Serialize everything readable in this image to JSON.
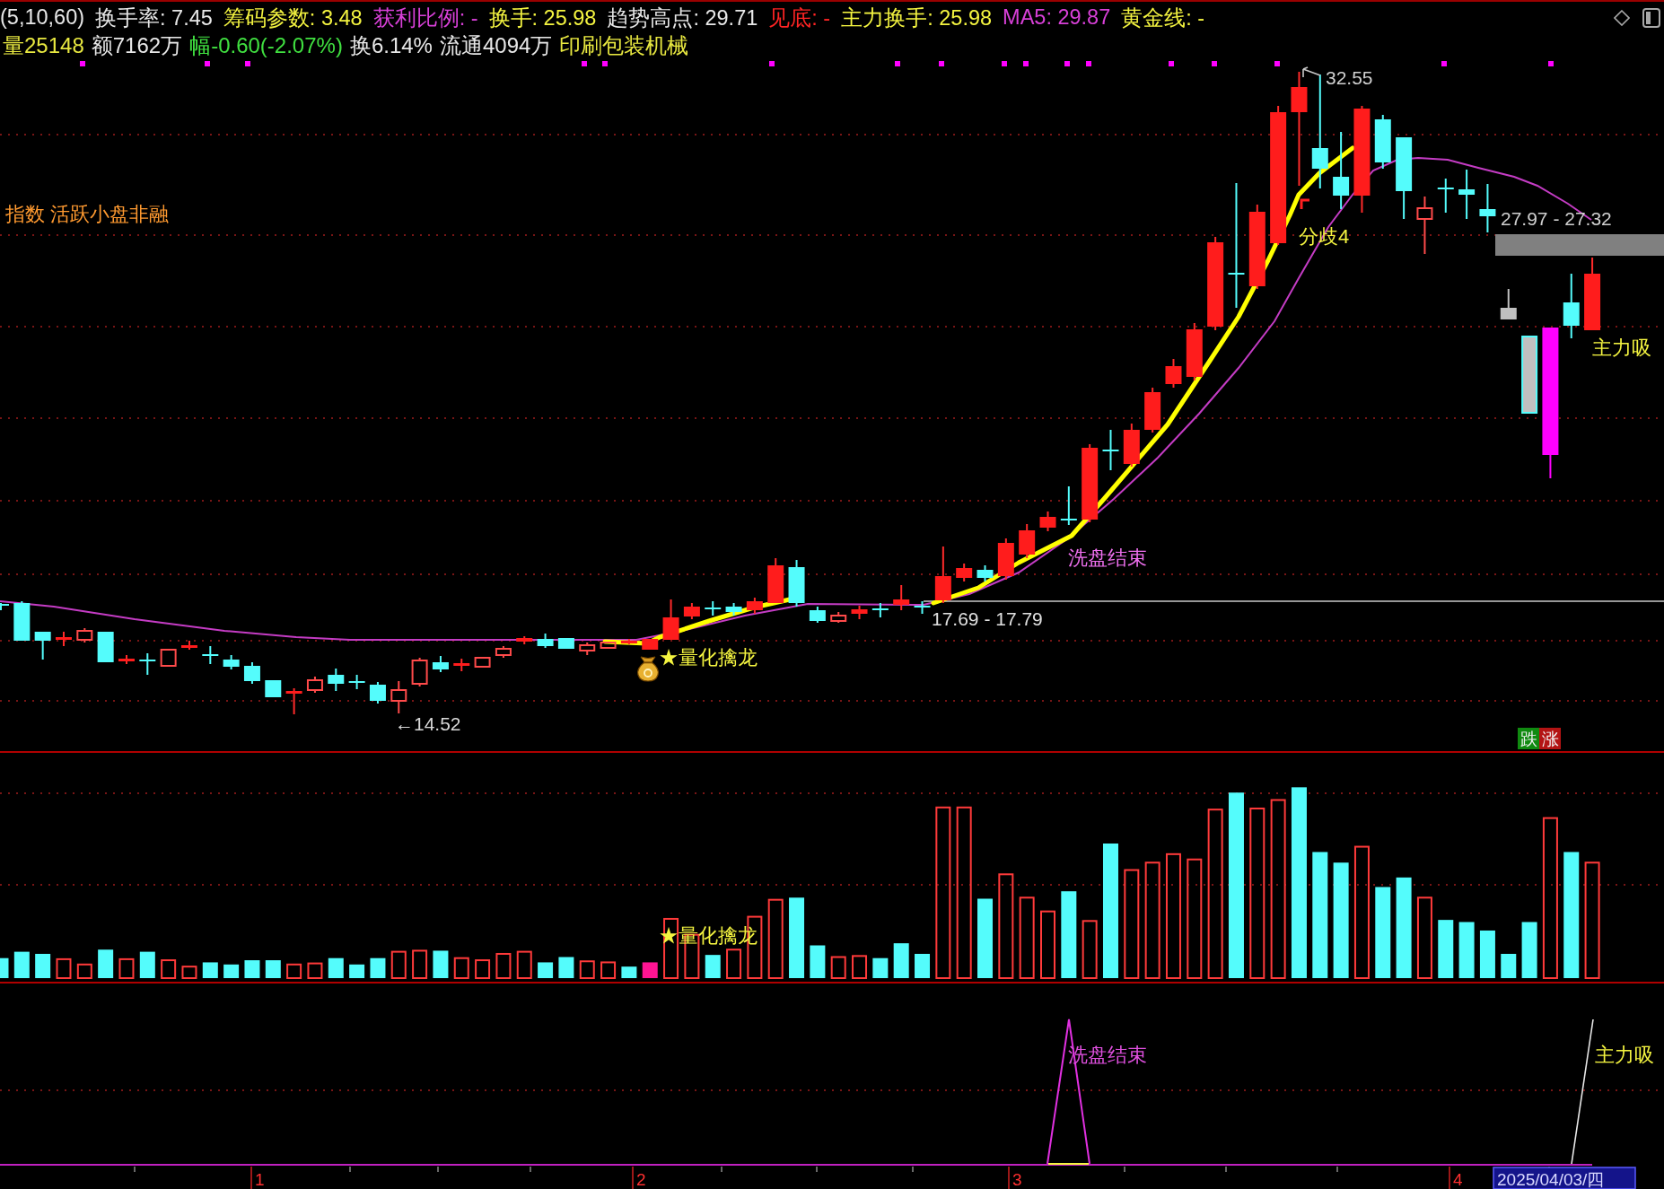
{
  "header": {
    "line_1": [
      {
        "text": "(5,10,60)",
        "color": "#e8e8e8"
      },
      {
        "text": "换手率: 7.45",
        "color": "#e8e8e8"
      },
      {
        "text": "筹码参数: 3.48",
        "color": "#f4f440"
      },
      {
        "text": "获利比例: -",
        "color": "#d840d8"
      },
      {
        "text": "换手: 25.98",
        "color": "#f4f440"
      },
      {
        "text": "趋势高点: 29.71",
        "color": "#e8e8e8"
      },
      {
        "text": "见底: -",
        "color": "#ff2424"
      },
      {
        "text": "主力换手: 25.98",
        "color": "#f4f440"
      },
      {
        "text": "MA5: 29.87",
        "color": "#d840d8"
      },
      {
        "text": "黄金线: -",
        "color": "#f4f440"
      }
    ],
    "line_2": [
      {
        "text": "量25148",
        "color": "#e8e840"
      },
      {
        "text": "额7162万",
        "color": "#e8e8e8"
      },
      {
        "text": "幅-0.60(-2.07%)",
        "color": "#40e040"
      },
      {
        "text": "换6.14%",
        "color": "#e8e8e8"
      },
      {
        "text": "流通4094万",
        "color": "#e8e8e8"
      },
      {
        "text": "印刷包装机械",
        "color": "#e8e840"
      }
    ]
  },
  "price_panel": {
    "high_label": "32.55",
    "sector_tags": "指数 活跃小盘非融",
    "range_label": "27.97 - 27.32",
    "divergence_label": "分歧4",
    "accumulation_label": "主力吸",
    "washout_label": "洗盘结束",
    "support_label": "17.69 - 17.79",
    "signal_label": "★量化擒龙",
    "low_label": "←14.52",
    "legend": [
      {
        "text": "跌",
        "color": "#108a10"
      },
      {
        "text": "涨",
        "color": "#b41414"
      }
    ]
  },
  "volume_panel": {
    "signal_label": "★量化擒龙"
  },
  "indicator_panel": {
    "washout_label": "洗盘结束",
    "accumulation_label": "主力吸"
  },
  "time_axis": {
    "months": [
      "1",
      "2",
      "3",
      "4"
    ],
    "date": "2025/04/03/四"
  }
}
